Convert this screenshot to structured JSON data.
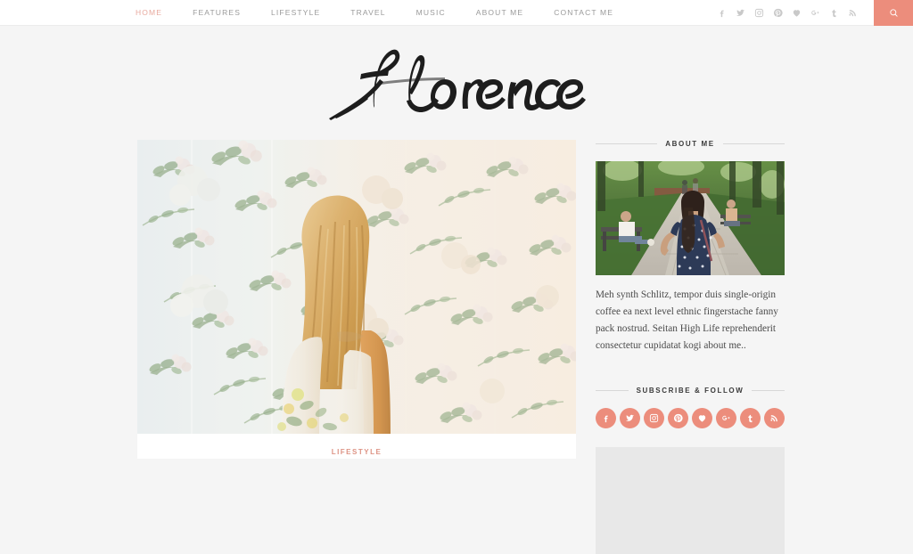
{
  "site": {
    "logo_text": "florence",
    "accent_color": "#ec8d7c",
    "accent_light": "#e8a99e",
    "page_bg": "#f5f5f5"
  },
  "header": {
    "nav": [
      {
        "label": "HOME",
        "active": true
      },
      {
        "label": "FEATURES",
        "active": false
      },
      {
        "label": "LIFESTYLE",
        "active": false
      },
      {
        "label": "TRAVEL",
        "active": false
      },
      {
        "label": "MUSIC",
        "active": false
      },
      {
        "label": "ABOUT ME",
        "active": false
      },
      {
        "label": "CONTACT ME",
        "active": false
      }
    ],
    "social": [
      {
        "name": "facebook-icon",
        "title": "Facebook"
      },
      {
        "name": "twitter-icon",
        "title": "Twitter"
      },
      {
        "name": "instagram-icon",
        "title": "Instagram"
      },
      {
        "name": "pinterest-icon",
        "title": "Pinterest"
      },
      {
        "name": "bloglovin-heart-icon",
        "title": "Bloglovin"
      },
      {
        "name": "google-plus-icon",
        "title": "Google Plus"
      },
      {
        "name": "tumblr-icon",
        "title": "Tumblr"
      },
      {
        "name": "rss-icon",
        "title": "RSS"
      }
    ],
    "search_label": "Search"
  },
  "main": {
    "featured_post": {
      "category": "LIFESTYLE",
      "image_alt": "Blonde woman from behind in a floral dress standing in front of floral wallpaper"
    }
  },
  "sidebar": {
    "about": {
      "title": "ABOUT ME",
      "image_alt": "Woman in navy polka dot dress walking on a park path",
      "text": "Meh synth Schlitz, tempor duis single-origin coffee ea next level ethnic fingerstache fanny pack nostrud. Seitan High Life reprehenderit consectetur cupidatat kogi about me.."
    },
    "subscribe": {
      "title": "SUBSCRIBE & FOLLOW",
      "social": [
        {
          "name": "facebook-icon",
          "title": "Facebook"
        },
        {
          "name": "twitter-icon",
          "title": "Twitter"
        },
        {
          "name": "instagram-icon",
          "title": "Instagram"
        },
        {
          "name": "pinterest-icon",
          "title": "Pinterest"
        },
        {
          "name": "bloglovin-heart-icon",
          "title": "Bloglovin"
        },
        {
          "name": "google-plus-icon",
          "title": "Google Plus"
        },
        {
          "name": "tumblr-icon",
          "title": "Tumblr"
        },
        {
          "name": "rss-icon",
          "title": "RSS"
        }
      ]
    }
  }
}
